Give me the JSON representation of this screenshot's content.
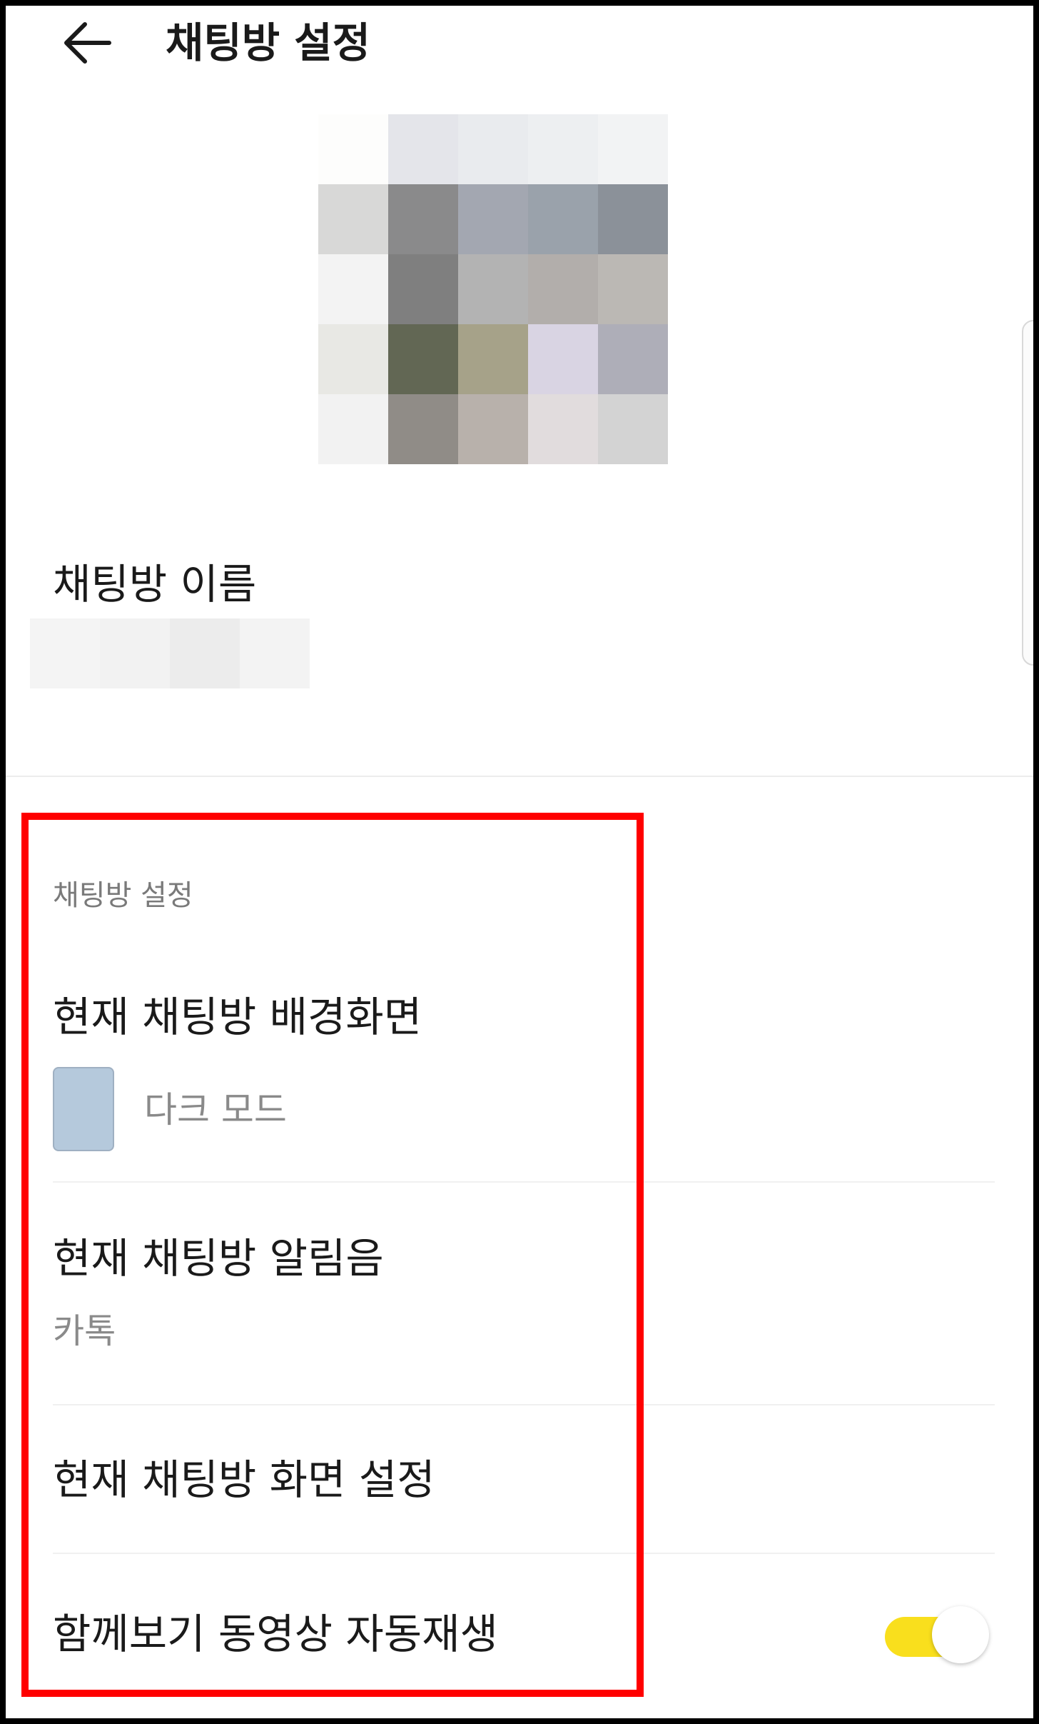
{
  "header": {
    "title": "채팅방 설정",
    "back_icon": "arrow-left-icon"
  },
  "profile": {
    "mosaic_colors": [
      "#fdfdfc",
      "#e4e5ea",
      "#e9ebee",
      "#edeff1",
      "#f2f3f4",
      "#d8d8d7",
      "#8a8a8b",
      "#a3a7b1",
      "#9aa2ab",
      "#8b9199",
      "#f3f3f3",
      "#7f7f7f",
      "#b3b3b3",
      "#b2aeab",
      "#bbb8b4",
      "#e8e8e4",
      "#626754",
      "#a6a289",
      "#d9d4e3",
      "#aeaeb8",
      "#f2f2f2",
      "#908c87",
      "#b8b1ab",
      "#e1dcdd",
      "#d3d3d3"
    ]
  },
  "room_name": {
    "label": "채팅방 이름",
    "blur_colors": [
      "#f4f4f4",
      "#f2f2f2",
      "#ececec",
      "#f3f3f3"
    ]
  },
  "settings": {
    "section_title": "채팅방 설정",
    "background": {
      "title": "현재 채팅방 배경화면",
      "value": "다크 모드",
      "swatch_color": "#b5c9dc"
    },
    "notification": {
      "title": "현재 채팅방 알림음",
      "value": "카톡"
    },
    "screen": {
      "title": "현재 채팅방 화면 설정"
    },
    "autoplay": {
      "title": "함께보기 동영상 자동재생",
      "enabled": true,
      "toggle_color": "#f9df1d"
    }
  },
  "annotation": {
    "highlight_color": "#ff0000"
  }
}
